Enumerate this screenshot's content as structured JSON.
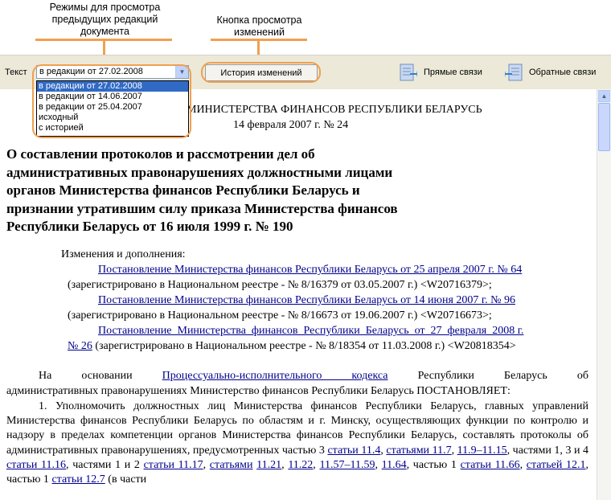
{
  "callouts": {
    "modes_line1": "Режимы для просмотра",
    "modes_line2": "предыдущих редакций",
    "modes_line3": "документа",
    "button_line1": "Кнопка просмотра",
    "button_line2": "изменений"
  },
  "toolbar": {
    "text_label": "Текст",
    "edition_selected": "в редакции от 27.02.2008",
    "history_button": "История изменений",
    "direct_links": "Прямые связи",
    "reverse_links": "Обратные связи"
  },
  "dropdown": {
    "options": [
      "в редакции от 27.02.2008",
      "в редакции от 14.06.2007",
      "в редакции от 25.04.2007",
      "исходный",
      "с историей"
    ]
  },
  "document": {
    "ministry": "МИНИСТЕРСТВА ФИНАНСОВ РЕСПУБЛИКИ БЕЛАРУСЬ",
    "date": "14 февраля 2007 г. № 24",
    "title_lines": [
      "О составлении протоколов и рассмотрении дел об",
      "административных правонарушениях должностными лицами",
      "органов Министерства финансов Республики Беларусь и",
      "признании утратившим силу приказа Министерства финансов",
      "Республики Беларусь от 16 июля 1999 г. № 190"
    ],
    "changes_label": "Изменения и дополнения:",
    "amend1_link": "Постановление Министерства финансов Республики Беларусь от 25 апреля 2007 г. № 64",
    "amend1_reg": "(зарегистрировано в Национальном реестре - № 8/16379 от 03.05.2007 г.) <W20716379>;",
    "amend2_link": "Постановление Министерства финансов Республики Беларусь от 14 июня 2007 г. № 96",
    "amend2_reg": "(зарегистрировано в Национальном реестре - № 8/16673 от 19.06.2007 г.) <W20716673>;",
    "amend3_link_a": "Постановление  Министерства  финансов  Республики  Беларусь  от  27  февраля  2008 г.",
    "amend3_link_b": "№ 26",
    "amend3_reg": " (зарегистрировано в Национальном реестре - № 8/18354 от 11.03.2008 г.) <W20818354>",
    "basis_pre": "На основании ",
    "basis_link": "Процессуально-исполнительного кодекса",
    "basis_post": " Республики Беларусь об",
    "basis_line2": "административных правонарушениях Министерство финансов Республики Беларусь ПОСТАНОВЛЯЕТ:",
    "p1_text": "1. Уполномочить должностных лиц Министерства финансов Республики Беларусь, главных управлений Министерства финансов Республики Беларусь по областям и г. Минску, осуществляющих функции по контролю и надзору в пределах компетенции органов Министерства финансов Республики Беларусь, составлять протоколы об административных правонарушениях, предусмотренных частью 3",
    "refs": {
      "r1": "статьи 11.4",
      "r2": "статьями 11.7",
      "r3": "11.9–11.15",
      "t1": ", частями 1, 3 и 4 ",
      "r4": "статьи 11.16",
      "t2": ", частями 1 и 2 ",
      "r5": "статьи 11.17",
      "r6": "статьями",
      "r7": "11.21",
      "r8": "11.22",
      "r9": "11.57–11.59",
      "r10": "11.64",
      "t3": ", частью 1 ",
      "r11": "статьи 11.66",
      "r12": "статьей 12.1",
      "t4": ", частью 1 ",
      "r13": "статьи 12.7",
      "t5": " (в части"
    }
  }
}
